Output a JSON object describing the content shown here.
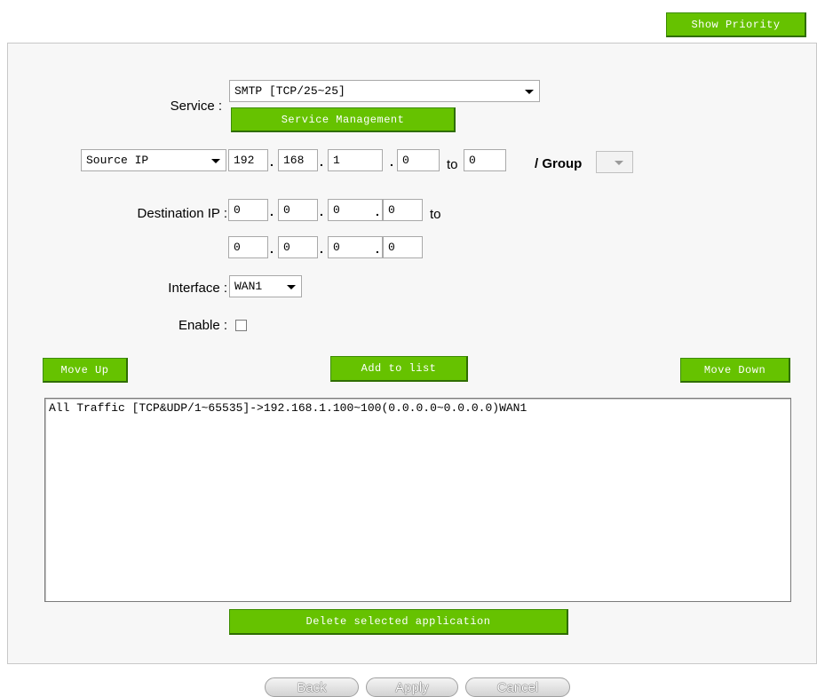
{
  "header": {
    "show_priority_label": "Show Priority"
  },
  "service": {
    "label": "Service :",
    "selected": "SMTP [TCP/25~25]",
    "management_button": "Service Management"
  },
  "source": {
    "type_selected": "Source IP",
    "ip": [
      "192",
      "168",
      "1",
      "0"
    ],
    "to_label": "to",
    "to_value": "0",
    "group_label": "/ Group"
  },
  "destination": {
    "label": "Destination IP :",
    "start": [
      "0",
      "0",
      "0",
      "0"
    ],
    "to_label": "to",
    "end": [
      "0",
      "0",
      "0",
      "0"
    ]
  },
  "interface": {
    "label": "Interface :",
    "selected": "WAN1"
  },
  "enable": {
    "label": "Enable :",
    "checked": false
  },
  "actions": {
    "move_up": "Move Up",
    "add_to_list": "Add to list",
    "move_down": "Move Down",
    "delete_selected": "Delete selected application"
  },
  "list": {
    "items": [
      "All Traffic [TCP&UDP/1~65535]->192.168.1.100~100(0.0.0.0~0.0.0.0)WAN1"
    ]
  },
  "footer": {
    "back": "Back",
    "apply": "Apply",
    "cancel": "Cancel"
  },
  "colors": {
    "accent_green": "#66c200",
    "panel_bg": "#f7f7f7"
  }
}
